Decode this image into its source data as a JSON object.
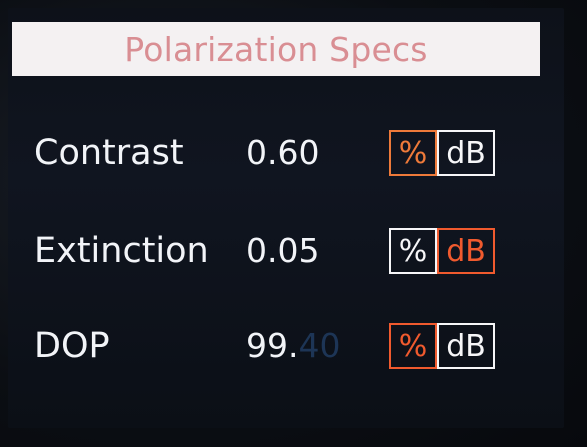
{
  "title": "Polarization Specs",
  "rows": [
    {
      "label": "Contrast",
      "value": "0.60",
      "value_dim": "",
      "units": {
        "percent": "%",
        "db": "dB"
      },
      "selected_unit": "%"
    },
    {
      "label": "Extinction",
      "value": "0.05",
      "value_dim": "",
      "units": {
        "percent": "%",
        "db": "dB"
      },
      "selected_unit": "dB"
    },
    {
      "label": "DOP",
      "value": "99.",
      "value_dim": "40",
      "units": {
        "percent": "%",
        "db": "dB"
      },
      "selected_unit": "%"
    }
  ],
  "colors": {
    "title_text": "#d98e93",
    "title_bg": "#f4f1f2",
    "text": "#f2f4f8",
    "unit_orange": "#ee7a3a",
    "unit_red": "#f05a2e",
    "unit_white": "#f6f6f8"
  }
}
